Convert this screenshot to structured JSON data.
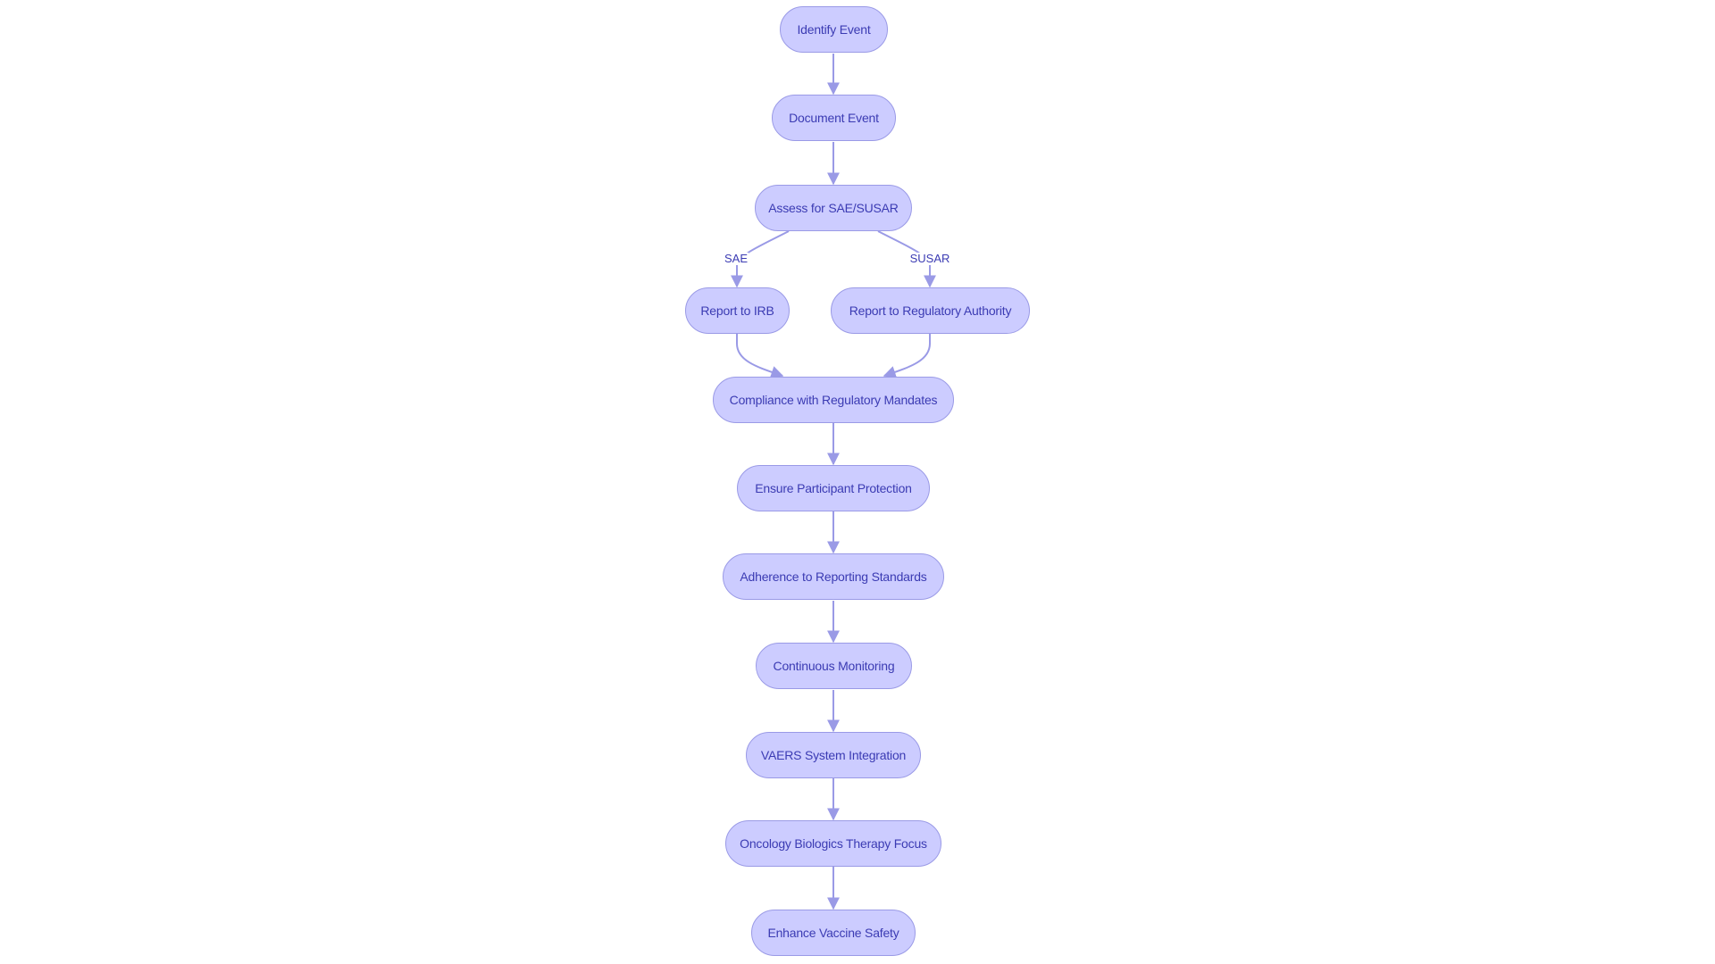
{
  "diagram": {
    "type": "flowchart",
    "direction": "top-to-bottom",
    "colors": {
      "node_fill": "#ccccff",
      "node_border": "#9a9ae6",
      "text": "#3b3bb3",
      "edge": "#9a9ae6",
      "background": "#ffffff"
    },
    "nodes": {
      "identify": "Identify Event",
      "document": "Document Event",
      "assess": "Assess for SAE/SUSAR",
      "irb": "Report to IRB",
      "reg": "Report to Regulatory Authority",
      "compliance": "Compliance with Regulatory Mandates",
      "ensure": "Ensure Participant Protection",
      "adherence": "Adherence to Reporting Standards",
      "continuous": "Continuous Monitoring",
      "vaers": "VAERS System Integration",
      "oncology": "Oncology Biologics Therapy Focus",
      "enhance": "Enhance Vaccine Safety"
    },
    "edges": [
      {
        "from": "identify",
        "to": "document",
        "label": ""
      },
      {
        "from": "document",
        "to": "assess",
        "label": ""
      },
      {
        "from": "assess",
        "to": "irb",
        "label": "SAE"
      },
      {
        "from": "assess",
        "to": "reg",
        "label": "SUSAR"
      },
      {
        "from": "irb",
        "to": "compliance",
        "label": ""
      },
      {
        "from": "reg",
        "to": "compliance",
        "label": ""
      },
      {
        "from": "compliance",
        "to": "ensure",
        "label": ""
      },
      {
        "from": "ensure",
        "to": "adherence",
        "label": ""
      },
      {
        "from": "adherence",
        "to": "continuous",
        "label": ""
      },
      {
        "from": "continuous",
        "to": "vaers",
        "label": ""
      },
      {
        "from": "vaers",
        "to": "oncology",
        "label": ""
      },
      {
        "from": "oncology",
        "to": "enhance",
        "label": ""
      }
    ],
    "edge_labels": {
      "sae": "SAE",
      "susar": "SUSAR"
    }
  }
}
